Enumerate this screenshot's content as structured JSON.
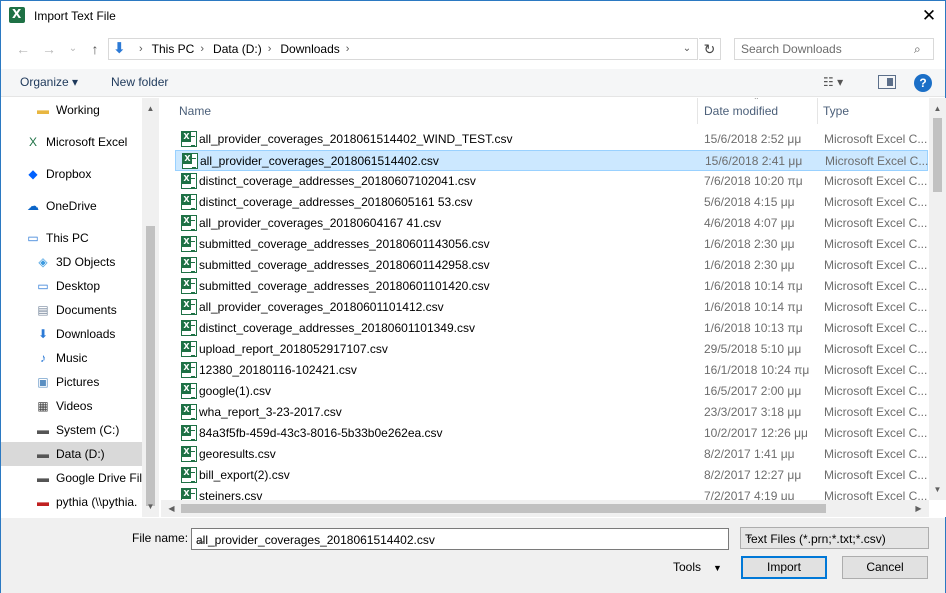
{
  "window": {
    "title": "Import Text File",
    "close_label": "✕"
  },
  "nav": {
    "back": "←",
    "forward": "→",
    "recent": "⌄",
    "up": "↑",
    "breadcrumbs": [
      "This PC",
      "Data (D:)",
      "Downloads"
    ],
    "search_placeholder": "Search Downloads"
  },
  "toolbar": {
    "organize": "Organize ▾",
    "new_folder": "New folder",
    "help": "?"
  },
  "sidebar": {
    "items": [
      {
        "label": "Working",
        "icon": "folder-icon"
      },
      {
        "label": "Microsoft Excel",
        "icon": "excel-icon"
      },
      {
        "label": "Dropbox",
        "icon": "dropbox-icon"
      },
      {
        "label": "OneDrive",
        "icon": "onedrive-icon"
      },
      {
        "label": "This PC",
        "icon": "pc-icon"
      },
      {
        "label": "3D Objects",
        "icon": "3d-objects-icon"
      },
      {
        "label": "Desktop",
        "icon": "desktop-icon"
      },
      {
        "label": "Documents",
        "icon": "documents-icon"
      },
      {
        "label": "Downloads",
        "icon": "downloads-icon"
      },
      {
        "label": "Music",
        "icon": "music-icon"
      },
      {
        "label": "Pictures",
        "icon": "pictures-icon"
      },
      {
        "label": "Videos",
        "icon": "videos-icon"
      },
      {
        "label": "System (C:)",
        "icon": "drive-icon"
      },
      {
        "label": "Data (D:)",
        "icon": "drive-icon",
        "selected": true
      },
      {
        "label": "Google Drive File",
        "icon": "drive-icon"
      },
      {
        "label": "pythia (\\\\pythia.",
        "icon": "network-drive-icon"
      }
    ]
  },
  "columns": {
    "name": "Name",
    "date": "Date modified",
    "type": "Type"
  },
  "files": [
    {
      "name": "all_provider_coverages_2018061514402_WIND_TEST.csv",
      "date": "15/6/2018 2:52 μμ",
      "type": "Microsoft Excel C..."
    },
    {
      "name": "all_provider_coverages_2018061514402.csv",
      "date": "15/6/2018 2:41 μμ",
      "type": "Microsoft Excel C...",
      "selected": true
    },
    {
      "name": "distinct_coverage_addresses_20180607102041.csv",
      "date": "7/6/2018 10:20 πμ",
      "type": "Microsoft Excel C..."
    },
    {
      "name": "distinct_coverage_addresses_20180605161 53.csv",
      "date": "5/6/2018 4:15 μμ",
      "type": "Microsoft Excel C..."
    },
    {
      "name": "all_provider_coverages_20180604167 41.csv",
      "date": "4/6/2018 4:07 μμ",
      "type": "Microsoft Excel C..."
    },
    {
      "name": "submitted_coverage_addresses_20180601143056.csv",
      "date": "1/6/2018 2:30 μμ",
      "type": "Microsoft Excel C..."
    },
    {
      "name": "submitted_coverage_addresses_20180601142958.csv",
      "date": "1/6/2018 2:30 μμ",
      "type": "Microsoft Excel C..."
    },
    {
      "name": "submitted_coverage_addresses_20180601101420.csv",
      "date": "1/6/2018 10:14 πμ",
      "type": "Microsoft Excel C..."
    },
    {
      "name": "all_provider_coverages_20180601101412.csv",
      "date": "1/6/2018 10:14 πμ",
      "type": "Microsoft Excel C..."
    },
    {
      "name": "distinct_coverage_addresses_20180601101349.csv",
      "date": "1/6/2018 10:13 πμ",
      "type": "Microsoft Excel C..."
    },
    {
      "name": "upload_report_2018052917107.csv",
      "date": "29/5/2018 5:10 μμ",
      "type": "Microsoft Excel C..."
    },
    {
      "name": "12380_20180116-102421.csv",
      "date": "16/1/2018 10:24 πμ",
      "type": "Microsoft Excel C..."
    },
    {
      "name": "google(1).csv",
      "date": "16/5/2017 2:00 μμ",
      "type": "Microsoft Excel C..."
    },
    {
      "name": "wha_report_3-23-2017.csv",
      "date": "23/3/2017 3:18 μμ",
      "type": "Microsoft Excel C..."
    },
    {
      "name": "84a3f5fb-459d-43c3-8016-5b33b0e262ea.csv",
      "date": "10/2/2017 12:26 μμ",
      "type": "Microsoft Excel C..."
    },
    {
      "name": "georesults.csv",
      "date": "8/2/2017 1:41 μμ",
      "type": "Microsoft Excel C..."
    },
    {
      "name": "bill_export(2).csv",
      "date": "8/2/2017 12:27 μμ",
      "type": "Microsoft Excel C..."
    },
    {
      "name": "steiners.csv",
      "date": "7/2/2017 4:19 μμ",
      "type": "Microsoft Excel C..."
    }
  ],
  "bottom": {
    "file_name_label": "File name:",
    "file_name_value": "all_provider_coverages_2018061514402.csv",
    "filter_value": "Text Files (*.prn;*.txt;*.csv)",
    "tools_label": "Tools",
    "import_label": "Import",
    "cancel_label": "Cancel"
  }
}
